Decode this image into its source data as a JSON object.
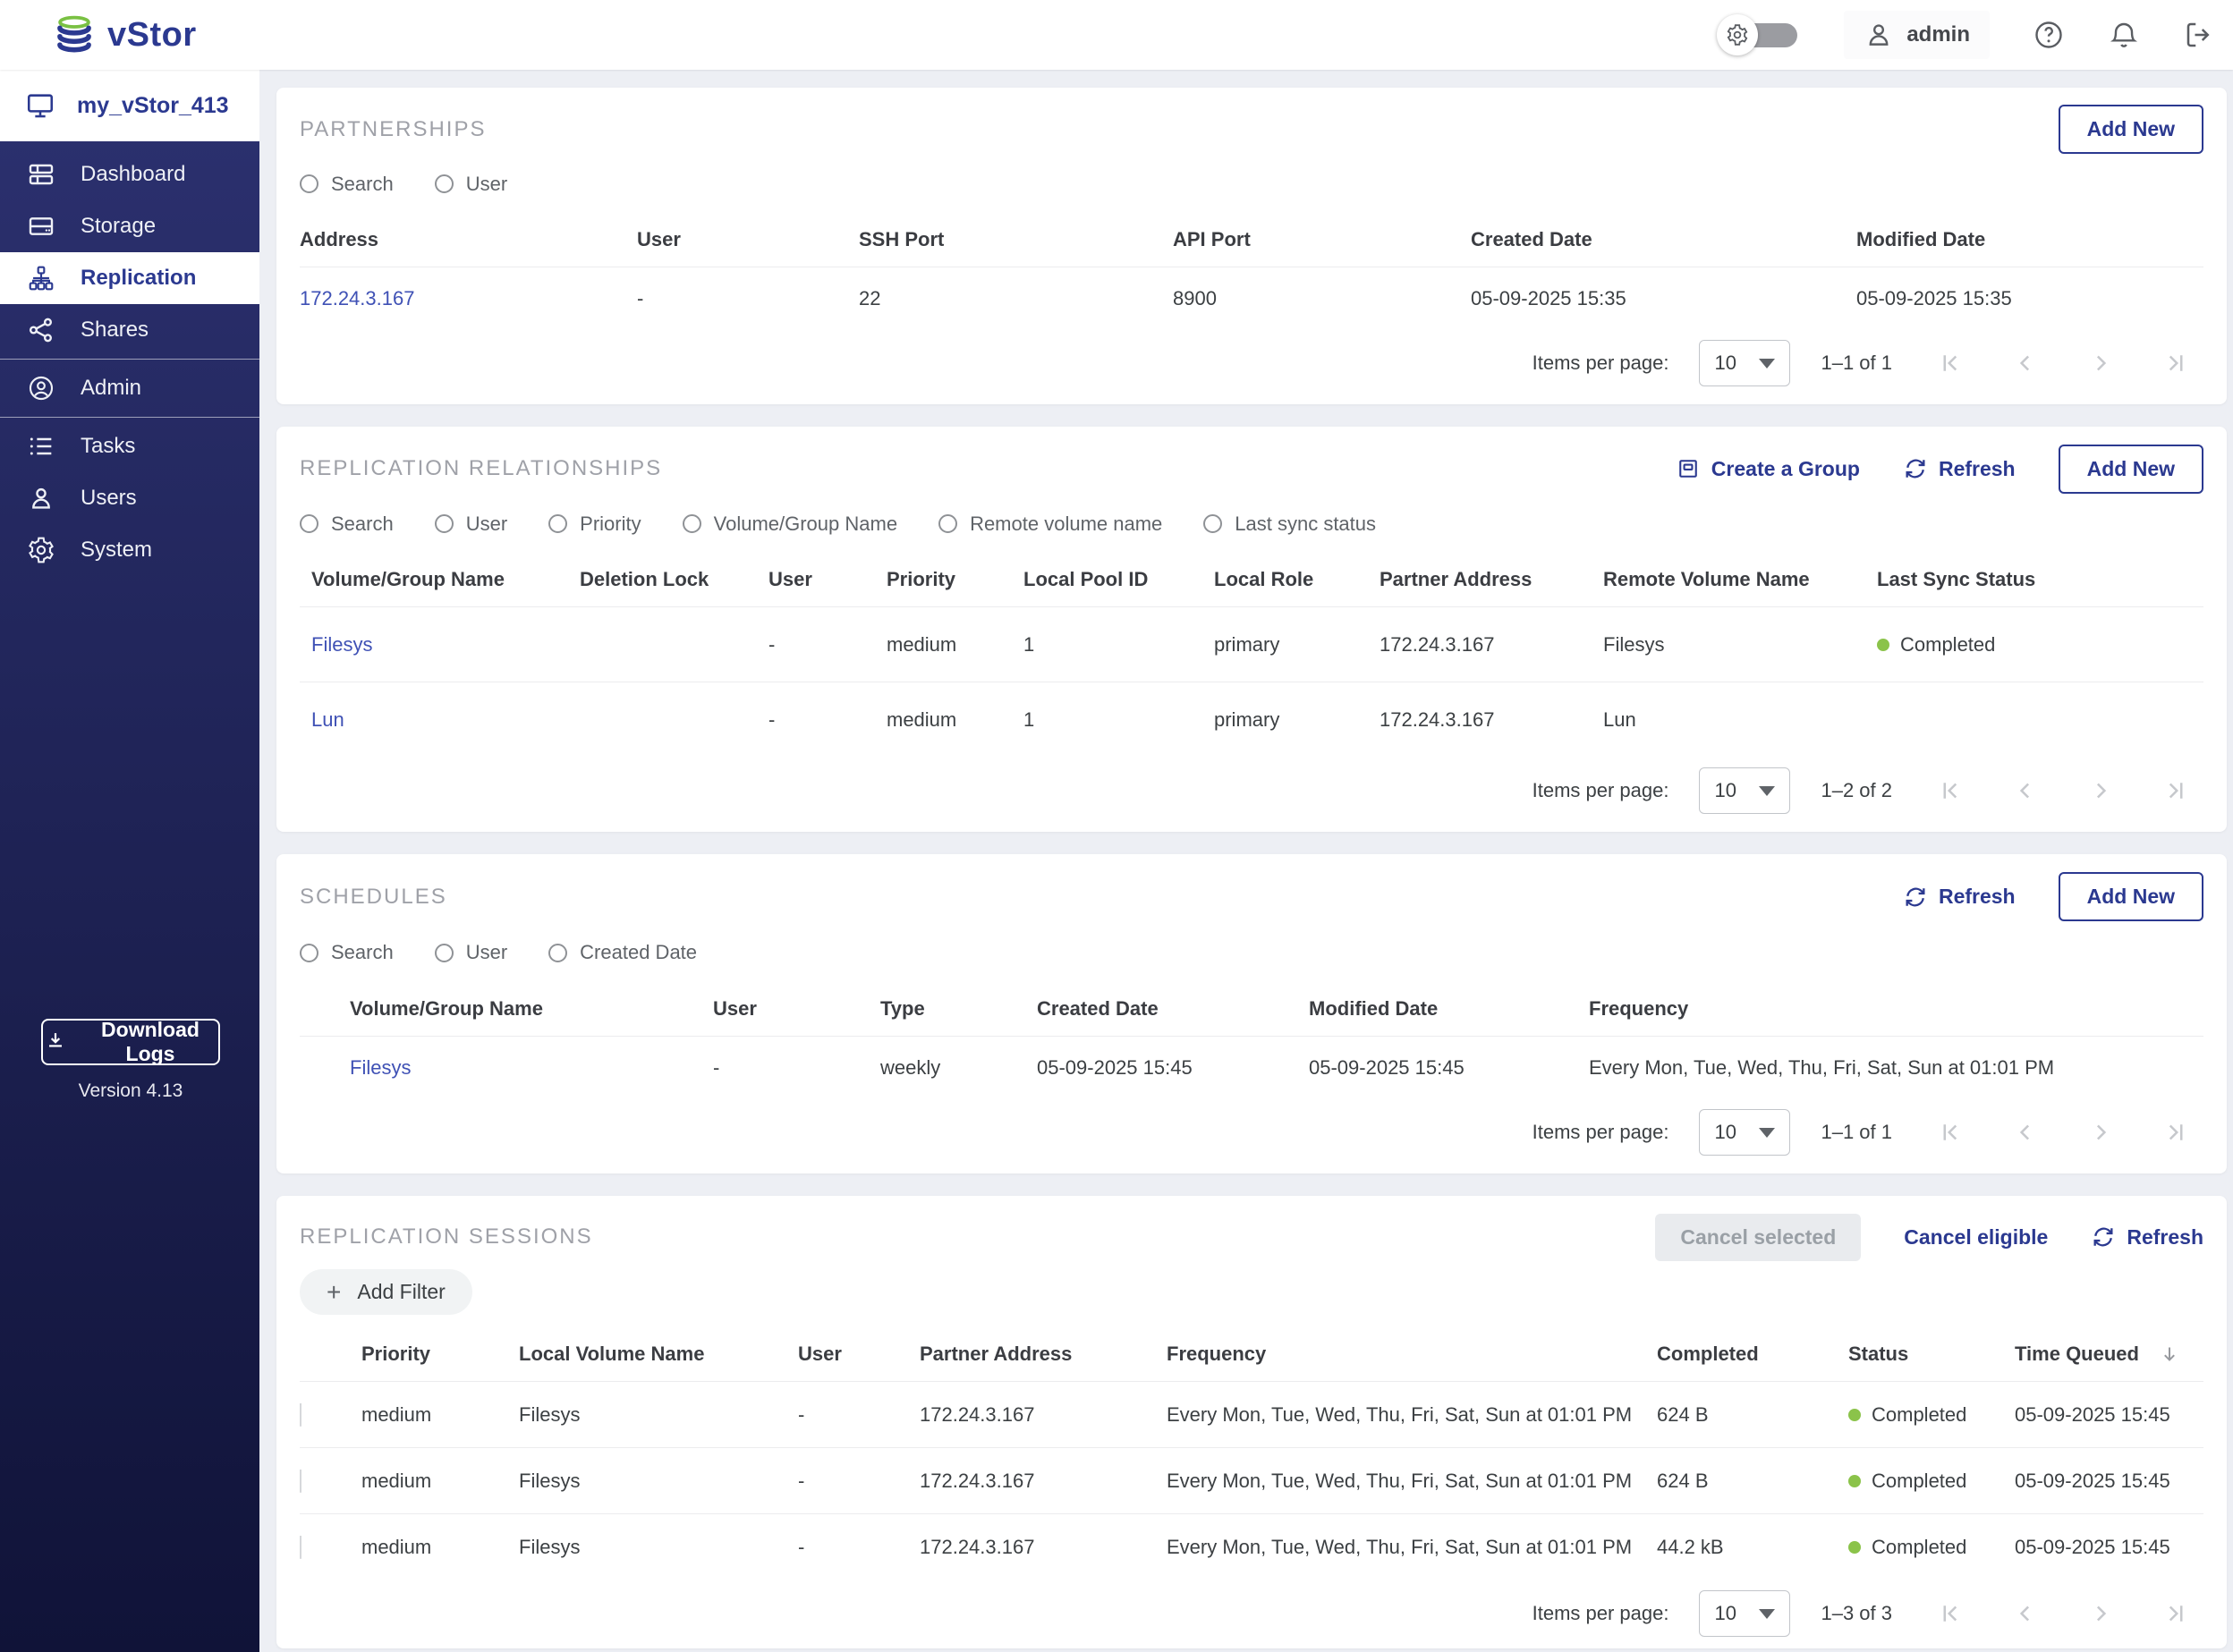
{
  "colors": {
    "accent": "#2b3990",
    "link": "#3f51b5",
    "status_green": "#8bc34a",
    "logo_green": "#7ac143"
  },
  "topbar": {
    "brand": "vStor",
    "user": "admin"
  },
  "sidebar": {
    "server_name": "my_vStor_413",
    "items": [
      {
        "label": "Dashboard"
      },
      {
        "label": "Storage"
      },
      {
        "label": "Replication"
      },
      {
        "label": "Shares"
      },
      {
        "label": "Admin"
      },
      {
        "label": "Tasks"
      },
      {
        "label": "Users"
      },
      {
        "label": "System"
      }
    ],
    "download_logs": "Download Logs",
    "version": "Version 4.13"
  },
  "partnerships": {
    "title": "PARTNERSHIPS",
    "add_new": "Add New",
    "filters": [
      "Search",
      "User"
    ],
    "columns": [
      "Address",
      "User",
      "SSH Port",
      "API Port",
      "Created Date",
      "Modified Date"
    ],
    "rows": [
      [
        "172.24.3.167",
        "-",
        "22",
        "8900",
        "05-09-2025 15:35",
        "05-09-2025 15:35"
      ]
    ],
    "pagination": {
      "label": "Items per page:",
      "page_size": "10",
      "range": "1–1 of 1"
    }
  },
  "relationships": {
    "title": "REPLICATION RELATIONSHIPS",
    "create_group": "Create a Group",
    "refresh": "Refresh",
    "add_new": "Add New",
    "filters": [
      "Search",
      "User",
      "Priority",
      "Volume/Group Name",
      "Remote volume name",
      "Last sync status"
    ],
    "columns": [
      "Volume/Group Name",
      "Deletion Lock",
      "User",
      "Priority",
      "Local Pool ID",
      "Local Role",
      "Partner Address",
      "Remote Volume Name",
      "Last Sync Status"
    ],
    "rows": [
      [
        "Filesys",
        "",
        "-",
        "medium",
        "1",
        "primary",
        "172.24.3.167",
        "Filesys",
        "Completed"
      ],
      [
        "Lun",
        "",
        "-",
        "medium",
        "1",
        "primary",
        "172.24.3.167",
        "Lun",
        ""
      ]
    ],
    "pagination": {
      "label": "Items per page:",
      "page_size": "10",
      "range": "1–2 of 2"
    }
  },
  "schedules": {
    "title": "SCHEDULES",
    "refresh": "Refresh",
    "add_new": "Add New",
    "filters": [
      "Search",
      "User",
      "Created Date"
    ],
    "columns": [
      "Volume/Group Name",
      "User",
      "Type",
      "Created Date",
      "Modified Date",
      "Frequency"
    ],
    "rows": [
      [
        "Filesys",
        "-",
        "weekly",
        "05-09-2025 15:45",
        "05-09-2025 15:45",
        "Every Mon, Tue, Wed, Thu, Fri, Sat, Sun at 01:01 PM"
      ]
    ],
    "pagination": {
      "label": "Items per page:",
      "page_size": "10",
      "range": "1–1 of 1"
    }
  },
  "sessions": {
    "title": "REPLICATION SESSIONS",
    "cancel_selected": "Cancel selected",
    "cancel_eligible": "Cancel eligible",
    "refresh": "Refresh",
    "add_filter": "Add Filter",
    "columns": [
      "Priority",
      "Local Volume Name",
      "User",
      "Partner Address",
      "Frequency",
      "Completed",
      "Status",
      "Time Queued"
    ],
    "rows": [
      [
        "medium",
        "Filesys",
        "-",
        "172.24.3.167",
        "Every Mon, Tue, Wed, Thu, Fri, Sat, Sun at 01:01 PM",
        "624 B",
        "Completed",
        "05-09-2025 15:45"
      ],
      [
        "medium",
        "Filesys",
        "-",
        "172.24.3.167",
        "Every Mon, Tue, Wed, Thu, Fri, Sat, Sun at 01:01 PM",
        "624 B",
        "Completed",
        "05-09-2025 15:45"
      ],
      [
        "medium",
        "Filesys",
        "-",
        "172.24.3.167",
        "Every Mon, Tue, Wed, Thu, Fri, Sat, Sun at 01:01 PM",
        "44.2 kB",
        "Completed",
        "05-09-2025 15:45"
      ]
    ],
    "pagination": {
      "label": "Items per page:",
      "page_size": "10",
      "range": "1–3 of 3"
    }
  }
}
